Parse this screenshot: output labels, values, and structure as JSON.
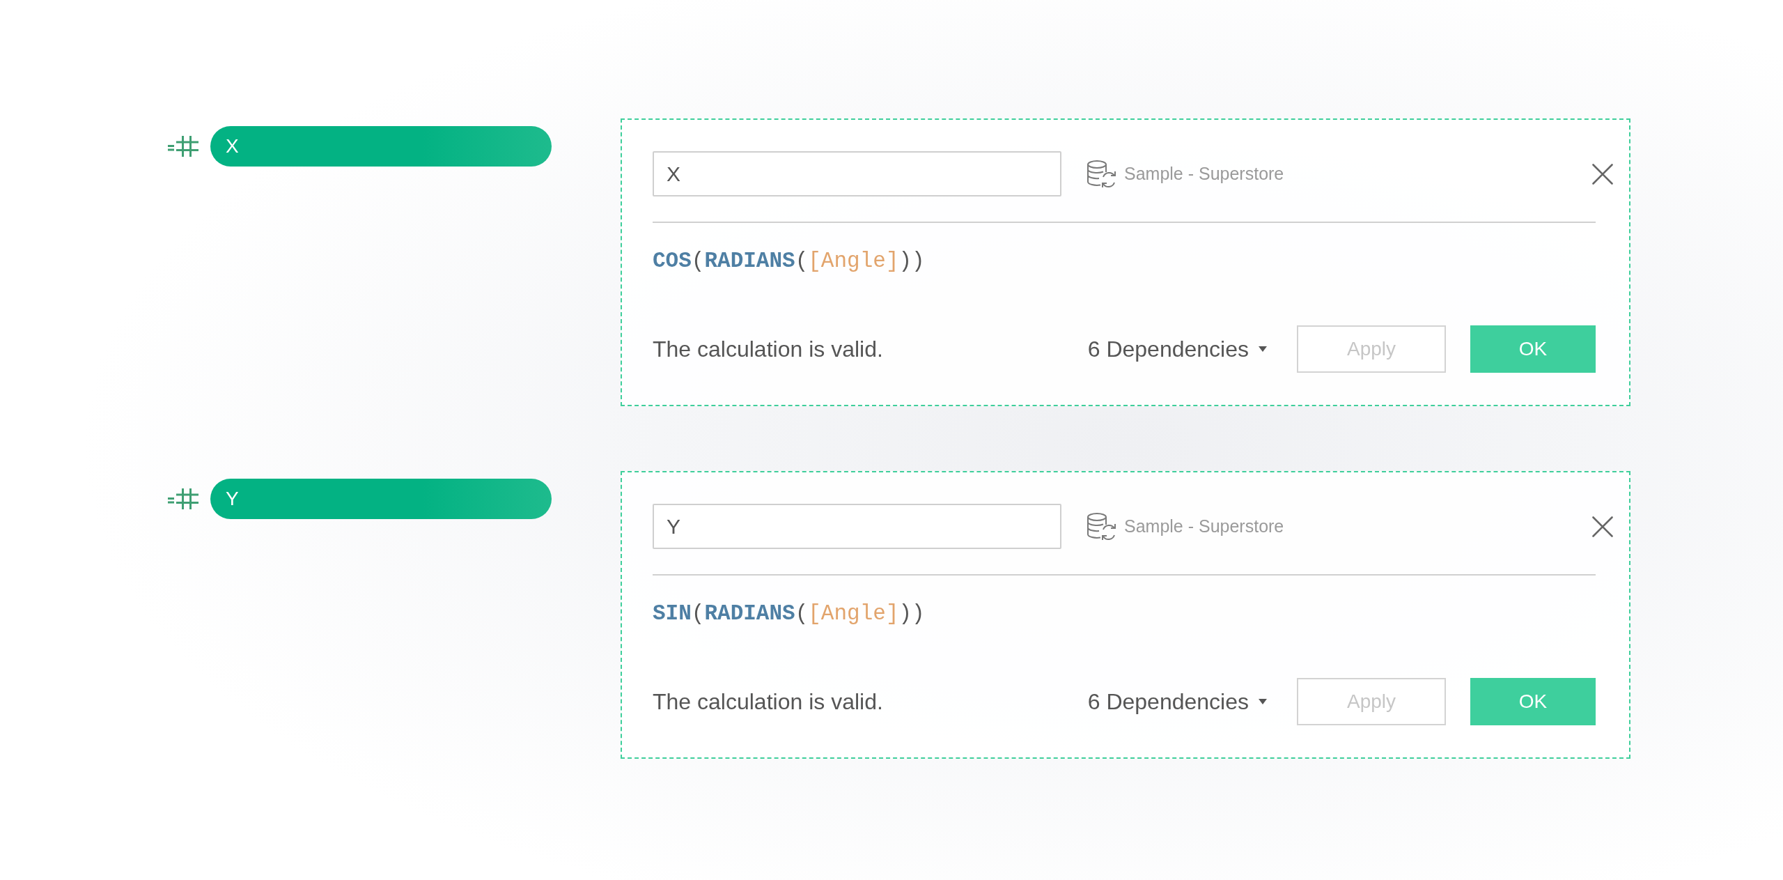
{
  "fields": [
    {
      "pill": {
        "label": "X"
      },
      "name_field": {
        "value": "X"
      },
      "datasource": "Sample - Superstore",
      "formula": [
        {
          "kind": "function",
          "text": "COS"
        },
        {
          "kind": "operator",
          "text": "("
        },
        {
          "kind": "function",
          "text": "RADIANS"
        },
        {
          "kind": "operator",
          "text": "("
        },
        {
          "kind": "field",
          "text": "[Angle]"
        },
        {
          "kind": "operator",
          "text": "))"
        }
      ],
      "status": "The calculation is valid.",
      "dependencies": "6 Dependencies",
      "buttons": [
        {
          "kind": "secondary",
          "label": "Apply",
          "disabled": true
        },
        {
          "kind": "primary",
          "label": "OK",
          "disabled": false
        }
      ]
    },
    {
      "pill": {
        "label": "Y"
      },
      "name_field": {
        "value": "Y"
      },
      "datasource": "Sample - Superstore",
      "formula": [
        {
          "kind": "function",
          "text": "SIN"
        },
        {
          "kind": "operator",
          "text": "("
        },
        {
          "kind": "function",
          "text": "RADIANS"
        },
        {
          "kind": "operator",
          "text": "("
        },
        {
          "kind": "field",
          "text": "[Angle]"
        },
        {
          "kind": "operator",
          "text": "))"
        }
      ],
      "status": "The calculation is valid.",
      "dependencies": "6 Dependencies",
      "buttons": [
        {
          "kind": "secondary",
          "label": "Apply",
          "disabled": true
        },
        {
          "kind": "primary",
          "label": "OK",
          "disabled": false
        }
      ]
    }
  ]
}
